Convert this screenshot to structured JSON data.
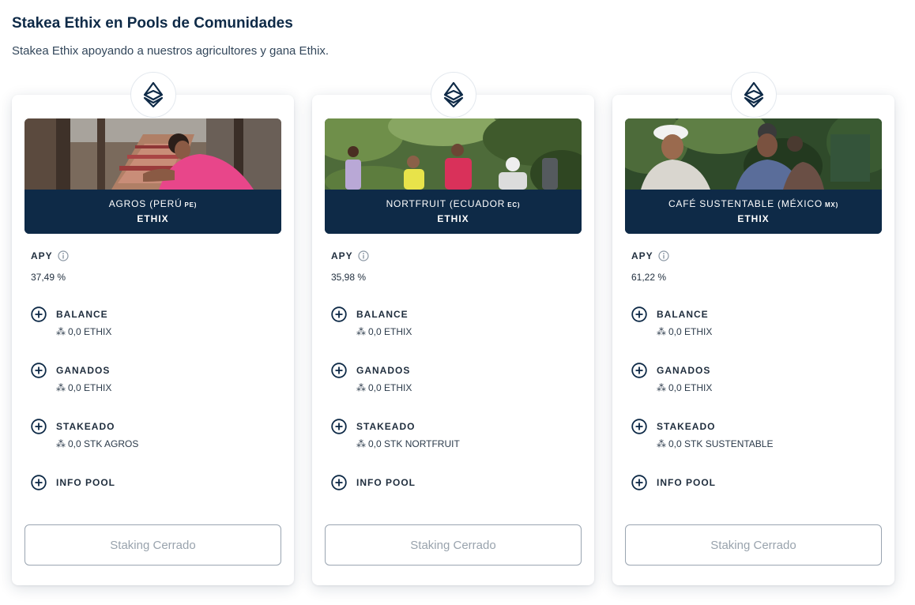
{
  "header": {
    "title": "Stakea Ethix en Pools de Comunidades",
    "subtitle": "Stakea Ethix apoyando a nuestros agricultores y gana Ethix."
  },
  "common": {
    "apy_label": "APY",
    "balance_label": "BALANCE",
    "earned_label": "GANADOS",
    "staked_label": "STAKEADO",
    "info_label": "INFO POOL",
    "value_symbol": "⁂",
    "button_label": "Staking Cerrado",
    "token": "ETHIX"
  },
  "pools": [
    {
      "name": "AGROS (PERÚ",
      "country": "PE)",
      "token": "ETHIX",
      "apy": "37,49 %",
      "balance": "0,0 ETHIX",
      "earned": "0,0 ETHIX",
      "staked": "0,0 STK AGROS"
    },
    {
      "name": "NORTFRUIT (ECUADOR",
      "country": "EC)",
      "token": "ETHIX",
      "apy": "35,98 %",
      "balance": "0,0 ETHIX",
      "earned": "0,0 ETHIX",
      "staked": "0,0 STK NORTFRUIT"
    },
    {
      "name": "CAFÉ SUSTENTABLE (MÉXICO",
      "country": "MX)",
      "token": "ETHIX",
      "apy": "61,22 %",
      "balance": "0,0 ETHIX",
      "earned": "0,0 ETHIX",
      "staked": "0,0 STK SUSTENTABLE"
    }
  ],
  "colors": {
    "brand_navy": "#0e2a47",
    "button_border": "#9aa5b1",
    "button_text": "#99a3ad"
  },
  "icons": {
    "token": "ethix-diamond-icon",
    "info": "info-circle-icon",
    "expand": "plus-circle-icon"
  }
}
